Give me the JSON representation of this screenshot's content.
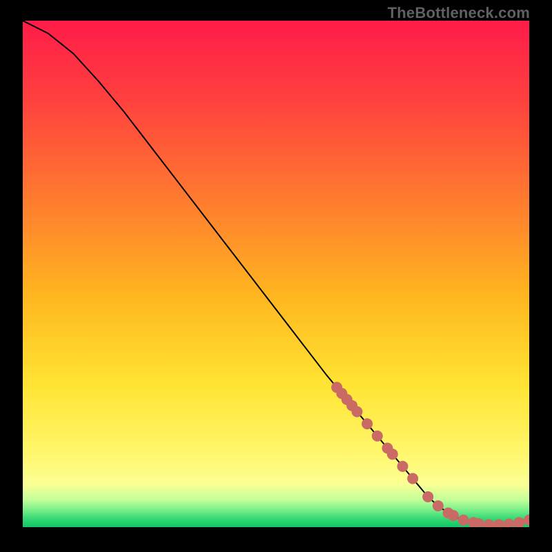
{
  "watermark": "TheBottleneck.com",
  "gradient_stops": [
    {
      "offset": 0.0,
      "color": "#ff1c49"
    },
    {
      "offset": 0.15,
      "color": "#ff3f3f"
    },
    {
      "offset": 0.35,
      "color": "#ff7a2f"
    },
    {
      "offset": 0.55,
      "color": "#ffb81f"
    },
    {
      "offset": 0.72,
      "color": "#ffe433"
    },
    {
      "offset": 0.85,
      "color": "#fff66a"
    },
    {
      "offset": 0.915,
      "color": "#fbff94"
    },
    {
      "offset": 0.945,
      "color": "#c5ff9a"
    },
    {
      "offset": 0.965,
      "color": "#7cf08a"
    },
    {
      "offset": 0.985,
      "color": "#2fd673"
    },
    {
      "offset": 1.0,
      "color": "#12c665"
    }
  ],
  "curve_color": "#000000",
  "marker_color": "#c96a64",
  "chart_data": {
    "type": "line",
    "title": "",
    "xlabel": "",
    "ylabel": "",
    "xlim": [
      0,
      100
    ],
    "ylim": [
      0,
      100
    ],
    "series": [
      {
        "name": "curve",
        "x": [
          0,
          5,
          10,
          15,
          20,
          25,
          30,
          35,
          40,
          45,
          50,
          55,
          60,
          65,
          70,
          72,
          74,
          76,
          78,
          80,
          82,
          84,
          86,
          88,
          90,
          92,
          94,
          96,
          98,
          100
        ],
        "y": [
          100,
          97.5,
          93.5,
          88,
          82,
          75.5,
          69,
          62.5,
          56,
          49.5,
          43,
          36.5,
          30,
          24,
          18,
          15.6,
          13.2,
          10.8,
          8.4,
          6.0,
          4.2,
          2.8,
          1.8,
          1.1,
          0.7,
          0.5,
          0.5,
          0.6,
          0.9,
          1.4
        ]
      }
    ],
    "markers": {
      "name": "highlighted-points",
      "x": [
        62,
        63,
        64,
        65,
        66,
        68,
        70,
        72,
        73,
        75,
        77,
        80,
        82,
        84,
        85,
        87,
        89,
        90,
        92,
        94,
        96,
        98,
        100
      ],
      "y": [
        27.6,
        26.4,
        25.2,
        24.0,
        22.8,
        20.4,
        18.0,
        15.6,
        14.4,
        12.0,
        9.6,
        6.0,
        4.2,
        2.8,
        2.3,
        1.4,
        0.9,
        0.7,
        0.5,
        0.5,
        0.6,
        0.9,
        1.4
      ]
    }
  }
}
